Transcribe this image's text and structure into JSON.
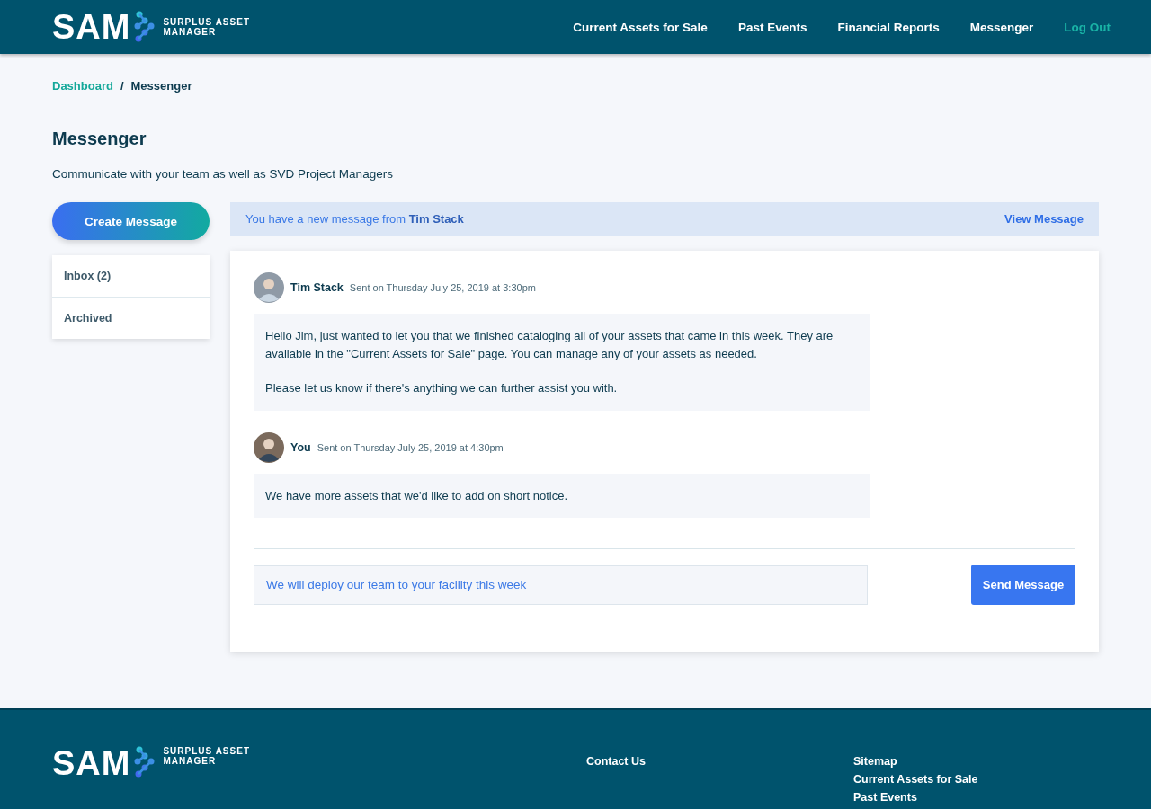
{
  "header": {
    "logo": {
      "mark": "SAM",
      "line1": "SURPLUS ASSET",
      "line2": "MANAGER"
    },
    "nav": [
      {
        "label": "Current Assets for Sale",
        "kind": "link"
      },
      {
        "label": "Past Events",
        "kind": "link"
      },
      {
        "label": "Financial Reports",
        "kind": "link"
      },
      {
        "label": "Messenger",
        "kind": "link"
      },
      {
        "label": "Log Out",
        "kind": "logout"
      }
    ]
  },
  "breadcrumb": [
    {
      "label": "Dashboard",
      "kind": "link"
    },
    {
      "label": "/",
      "kind": "separator"
    },
    {
      "label": "Messenger",
      "kind": "current"
    }
  ],
  "page": {
    "title": "Messenger",
    "subtitle": "Communicate with your team as well as SVD Project Managers"
  },
  "sidebar": {
    "button": "Create Message",
    "items": [
      {
        "label": "Inbox (2)",
        "selected": false
      },
      {
        "label": "Archived",
        "selected": false
      }
    ]
  },
  "notice": {
    "text": "You have a new message from **Tim Stack**",
    "action": "View Message"
  },
  "messages": [
    {
      "sender": "Tim Stack",
      "sent": "Sent on Thursday July 25, 2019 at 3:30pm",
      "paragraphs": [
        "Hello Jim, just wanted to let you that we finished cataloging all of your assets that came in this week. They are available in the \"Current Assets for Sale\" page. You can manage any of your assets as needed.",
        "Please let us know if there's anything we can further assist you with."
      ]
    },
    {
      "sender": "You",
      "sent": "Sent on Thursday July 25, 2019 at 4:30pm",
      "paragraphs": [
        "We have more assets that we'd like to add on short notice."
      ]
    }
  ],
  "reply": {
    "value": "We will deploy our team to your facility this week",
    "button": "Send Message"
  },
  "footer": {
    "logo": {
      "mark": "SAM",
      "line1": "SURPLUS ASSET",
      "line2": "MANAGER"
    },
    "contact": "Contact Us",
    "sitemap": {
      "title": "Sitemap",
      "links": [
        "Current Assets for Sale",
        "Past Events"
      ]
    }
  }
}
